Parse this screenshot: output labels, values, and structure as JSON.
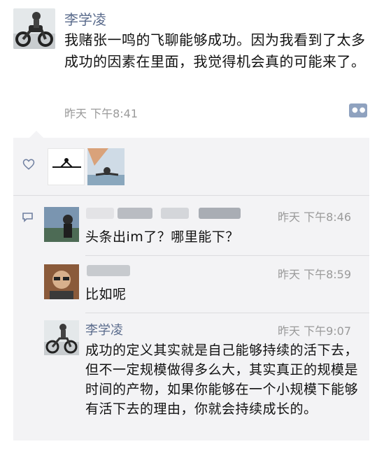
{
  "post": {
    "author": "李学凌",
    "text": "我赌张一鸣的飞聊能够成功。因为我看到了太多成功的因素在里面，我觉得机会真的可能来了。",
    "time": "昨天 下午8:41"
  },
  "icons": {
    "post_avatar": "motorcycle-rider-avatar",
    "comment_button": "more-dots-icon",
    "like": "heart-icon",
    "comment": "comment-bubble-icon"
  },
  "colors": {
    "name_link": "#5a6b8c",
    "timestamp": "#9a9a9a",
    "panel_bg": "#f3f3f5",
    "comment_button": "#8fa2bf"
  },
  "comments": [
    {
      "author": "",
      "time": "昨天 下午8:46",
      "text": "头条出im了？哪里能下？"
    },
    {
      "author": "",
      "time": "昨天 下午8:59",
      "text": "比如呢"
    },
    {
      "author": "李学凌",
      "time": "昨天 下午9:07",
      "text": "成功的定义其实就是自己能够持续的活下去，但不一定规模做得多么大，其实真正的规模是时间的产物，如果你能够在一个小规模下能够有活下去的理由，你就会持续成长的。"
    }
  ]
}
